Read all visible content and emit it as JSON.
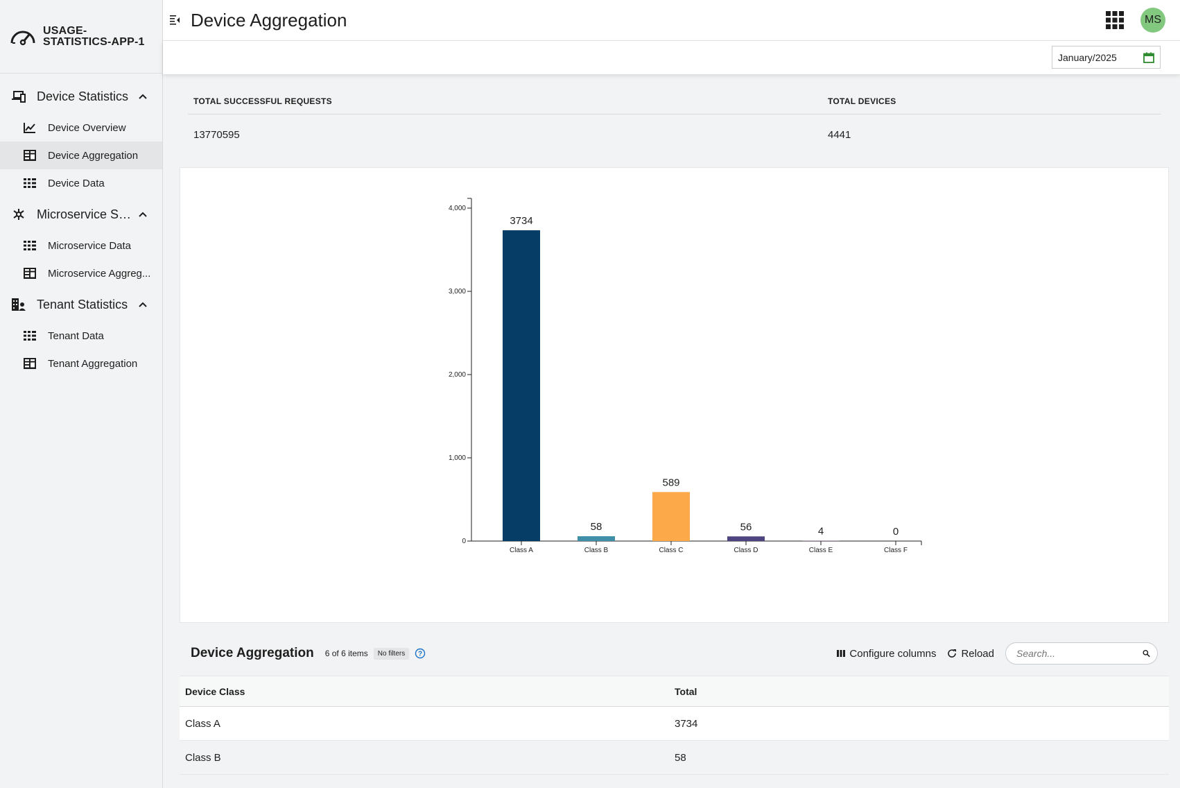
{
  "app": {
    "name_line1": "USAGE-",
    "name_line2": "STATISTICS-APP-1"
  },
  "sidebar": {
    "groups": [
      {
        "label": "Device Statistics",
        "icon": "devices-icon",
        "items": [
          {
            "label": "Device Overview",
            "icon": "line-chart-icon"
          },
          {
            "label": "Device Aggregation",
            "icon": "aggregate-table-icon",
            "active": true
          },
          {
            "label": "Device Data",
            "icon": "grid-list-icon"
          }
        ]
      },
      {
        "label": "Microservice Sta...",
        "icon": "microservice-icon",
        "items": [
          {
            "label": "Microservice Data",
            "icon": "grid-list-icon"
          },
          {
            "label": "Microservice Aggreg...",
            "icon": "aggregate-table-icon"
          }
        ]
      },
      {
        "label": "Tenant Statistics",
        "icon": "tenant-icon",
        "items": [
          {
            "label": "Tenant Data",
            "icon": "grid-list-icon"
          },
          {
            "label": "Tenant Aggregation",
            "icon": "aggregate-table-icon"
          }
        ]
      }
    ]
  },
  "header": {
    "title": "Device Aggregation",
    "avatar_initials": "MS",
    "avatar_color": "#82c97f"
  },
  "actionbar": {
    "date_value": "January/2025"
  },
  "kpi": {
    "total_requests_label": "TOTAL SUCCESSFUL REQUESTS",
    "total_requests_value": "13770595",
    "total_devices_label": "TOTAL DEVICES",
    "total_devices_value": "4441"
  },
  "chart_data": {
    "type": "bar",
    "categories": [
      "Class A",
      "Class B",
      "Class C",
      "Class D",
      "Class E",
      "Class F"
    ],
    "values": [
      3734,
      58,
      589,
      56,
      4,
      0
    ],
    "colors": [
      "#063d66",
      "#3f8fa8",
      "#fca94a",
      "#4e4580",
      "#7a4a7a",
      "#7a4a7a"
    ],
    "ylim": [
      0,
      4000
    ],
    "yticks": [
      0,
      1000,
      2000,
      3000,
      4000
    ],
    "ytick_labels": [
      "0",
      "1,000",
      "2,000",
      "3,000",
      "4,000"
    ],
    "title": "",
    "xlabel": "",
    "ylabel": "",
    "grid": false
  },
  "table": {
    "title": "Device Aggregation",
    "count_text": "6 of 6 items",
    "filter_text": "No filters",
    "configure_label": "Configure columns",
    "reload_label": "Reload",
    "search_placeholder": "Search...",
    "columns": [
      "Device Class",
      "Total"
    ],
    "rows": [
      [
        "Class A",
        "3734"
      ],
      [
        "Class B",
        "58"
      ]
    ]
  }
}
